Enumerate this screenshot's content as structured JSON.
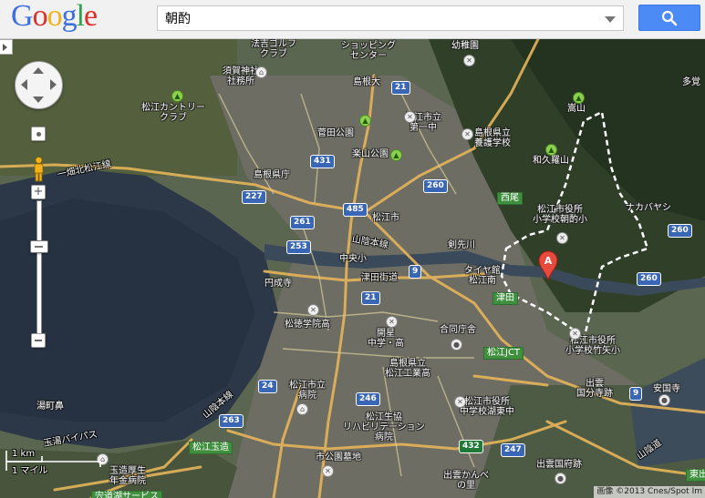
{
  "header": {
    "logo": [
      "G",
      "o",
      "o",
      "g",
      "l",
      "e"
    ],
    "logo_colors": [
      "#3d6fe0",
      "#d9322c",
      "#f2b21b",
      "#3d6fe0",
      "#2ea24c",
      "#d9322c"
    ],
    "search": {
      "value": "朝酌",
      "placeholder": ""
    }
  },
  "map": {
    "labels": {
      "golf": "法吉ゴルフ\nクラブ",
      "shopping": "ショッピング\nセンター",
      "kindergarten": "幼稚園",
      "tako": "多覚",
      "kaga": "須賀神社\n社務所",
      "matsue_cc": "松江カントリー\nクラブ",
      "shimane_univ": "島根大",
      "matsue_high": "松江市立\n第一中",
      "gyoho": "島根県立\n養護学校",
      "hoshiyama": "嵩山",
      "wakura": "和久羅山",
      "suga_park": "菅田公園",
      "rakuzan": "楽山公園",
      "ichibata": "一畑北松江線",
      "prefecture": "島根県庁",
      "nishio": "西尾",
      "city_office": "松江市役所\n小学校朝酌小",
      "nakabayashi": "ナカバヤシ",
      "matsue_city": "松江市",
      "sanin_line": "山陰本線",
      "kenshikawa": "剣先川",
      "chuo_sho": "中央小",
      "tsuda": "津田街道",
      "tiyakan": "タイヤ館\n松江南",
      "tsuda_area": "津田",
      "enseiji": "円成寺",
      "matsutoku": "松徳学院高",
      "kaimei": "開星\n中学・高",
      "godo": "合同庁舎",
      "matsue_jct": "松江JCT",
      "yatsuka": "松江市役所\n小学校竹矢小",
      "izumo_kokubunji": "出雲\n国分寺跡",
      "anku": "安国寺",
      "city_hospital": "松江市立\n病院",
      "kogyo": "島根県立\n松江工業高",
      "konan": "松江市役所\n中学校湖東中",
      "yumachi": "湯町鼻",
      "sanin_line2": "山陰本線",
      "reha": "松江生協\nリハビリテーション\n病院",
      "tamayu_bypass": "玉湯バイパス",
      "tamatsukuri": "松江玉造",
      "kosei": "玉造厚生\n年金病院",
      "delivery": "宍道湖サービス",
      "cemetery": "市公園墓地",
      "izumo_kanbe": "出雲かんべ\nの里",
      "kokuchohou": "出雲国府跡",
      "sanin_road": "山陰道",
      "higashi": "東出",
      "tako2": "多覚"
    },
    "routes": [
      "21",
      "431",
      "260",
      "227",
      "261",
      "485",
      "253",
      "9",
      "21",
      "24",
      "263",
      "246",
      "432",
      "247",
      "9",
      "260",
      "260"
    ],
    "scale": {
      "km": "1 km",
      "mile": "1 マイル"
    },
    "copyright": "画像 ©2013 Cnes/Spot Im"
  }
}
